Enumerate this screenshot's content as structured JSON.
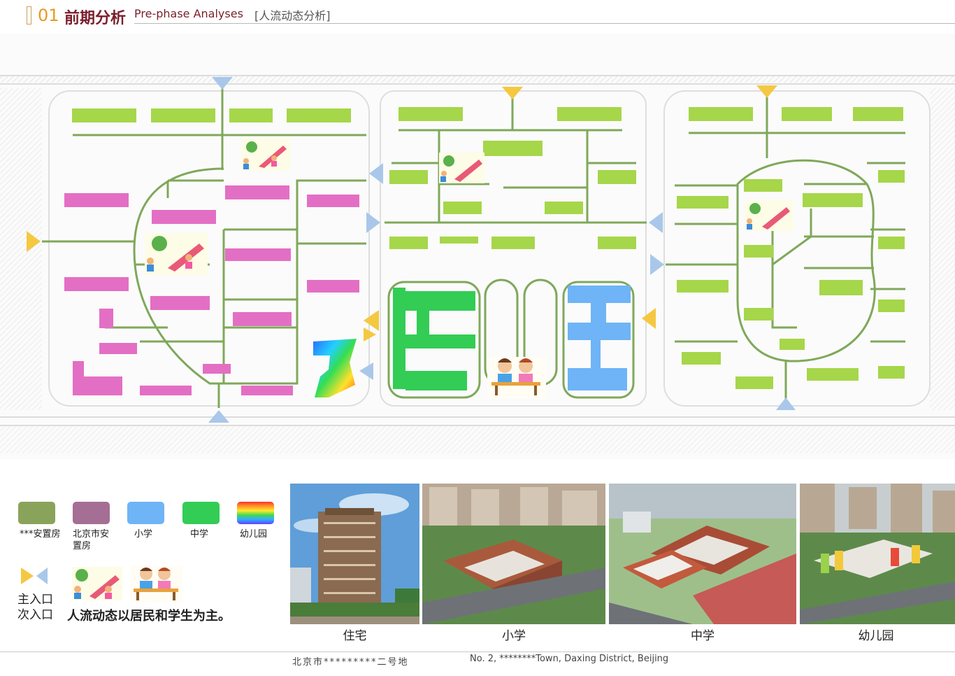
{
  "header": {
    "number": "01",
    "title_zh": "前期分析",
    "title_en": "Pre-phase Analyses",
    "subtitle": "[人流动态分析]"
  },
  "legend": {
    "items": [
      {
        "label": "***安置房",
        "color": "#8aa35a"
      },
      {
        "label": "北京市安\n置房",
        "color": "#a56e95"
      },
      {
        "label": "小学",
        "color": "#6eb4f6"
      },
      {
        "label": "中学",
        "color": "#33cc55"
      },
      {
        "label": "幼儿园",
        "color": "rainbow"
      }
    ],
    "main_entrance": "主入口",
    "secondary_entrance": "次入口",
    "note": "人流动态以居民和学生为主。"
  },
  "photos": [
    {
      "caption": "住宅"
    },
    {
      "caption": "小学"
    },
    {
      "caption": "中学"
    },
    {
      "caption": "幼儿园"
    }
  ],
  "footer": {
    "left": "北京市*********二号地",
    "right": "No. 2, ********Town, Daxing District, Beijing"
  },
  "colors": {
    "path_green": "#7fa85a",
    "lime": "#a6d64a",
    "pink": "#e36fc4",
    "school_green": "#33cc55",
    "school_blue": "#6eb4f6",
    "main_entry": "#f5c842",
    "secondary_entry": "#a9c7ea"
  },
  "icons": [
    "playground-icon",
    "students-icon",
    "main-entrance-icon",
    "secondary-entrance-icon"
  ]
}
